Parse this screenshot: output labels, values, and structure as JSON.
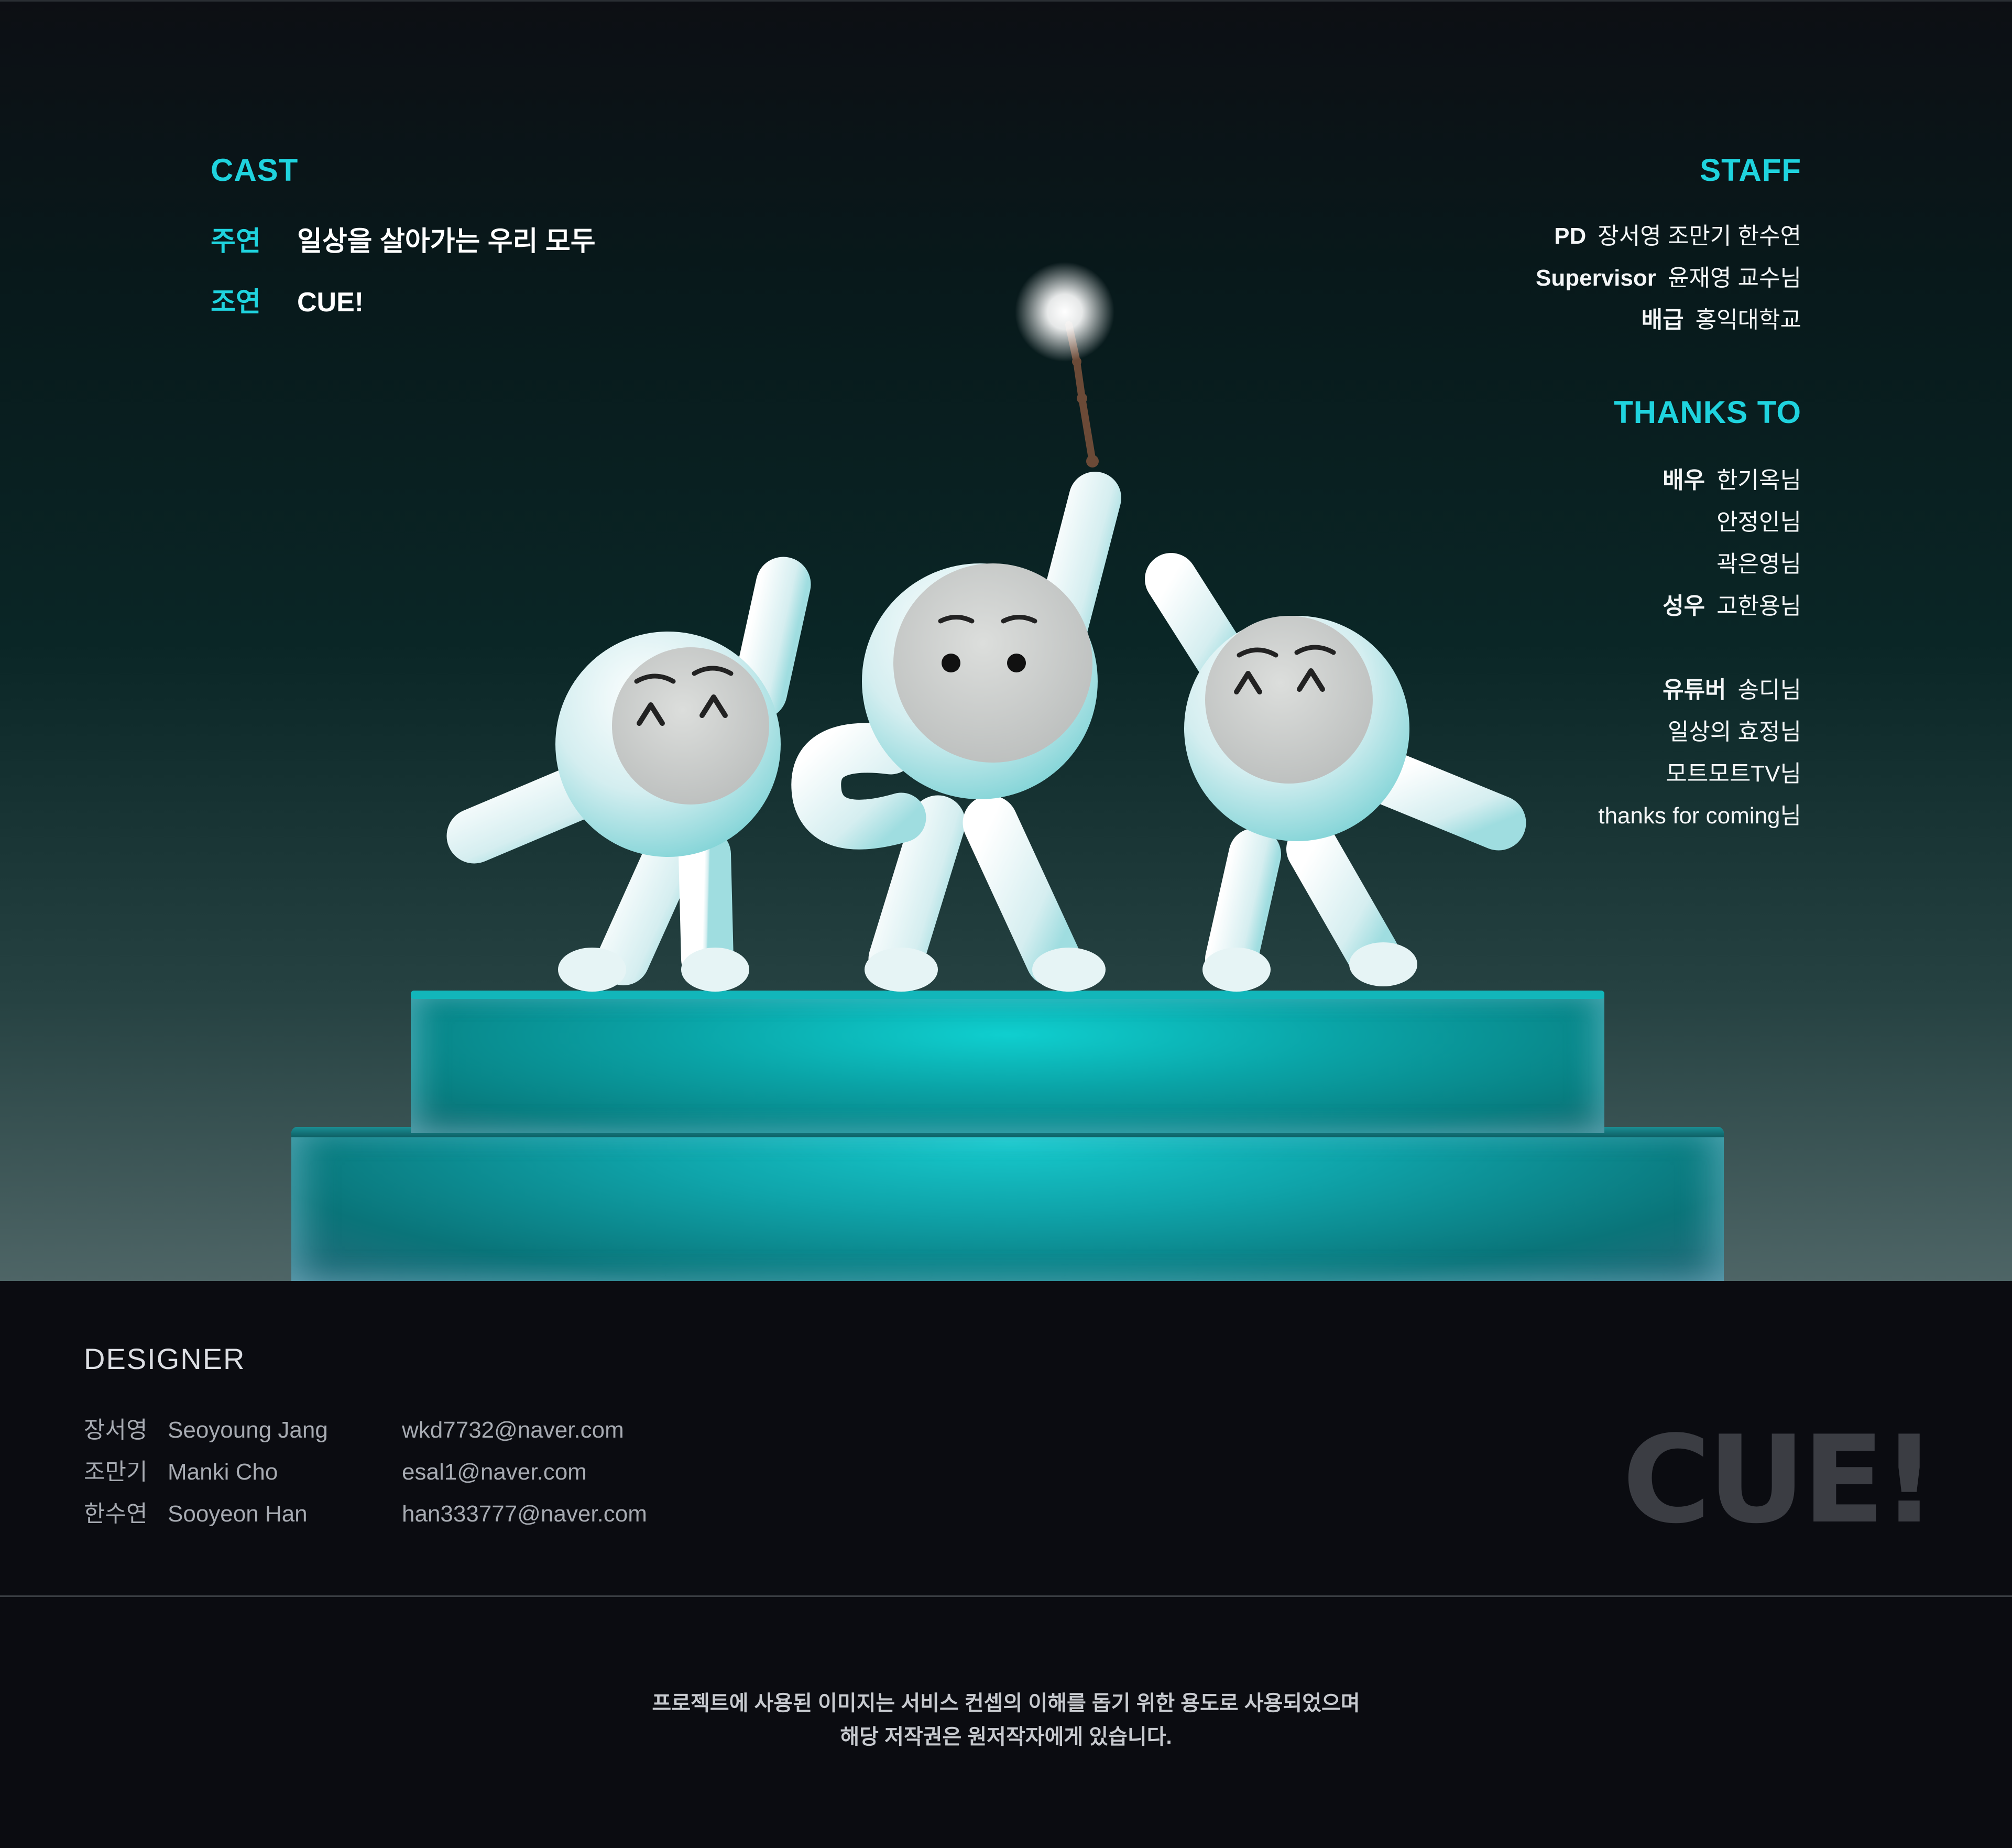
{
  "cast": {
    "title": "CAST",
    "rows": [
      {
        "role": "주연",
        "name": "일상을 살아가는 우리 모두"
      },
      {
        "role": "조연",
        "name": "CUE!"
      }
    ]
  },
  "staff": {
    "title": "STAFF",
    "rows": [
      {
        "key": "PD",
        "value": "장서영 조만기 한수연"
      },
      {
        "key": "Supervisor",
        "value": "윤재영 교수님"
      },
      {
        "key": "배급",
        "value": "홍익대학교"
      }
    ]
  },
  "thanks": {
    "title": "THANKS TO",
    "rows": [
      {
        "key": "배우",
        "value": "한기옥님"
      },
      {
        "key": "",
        "value": "안정인님"
      },
      {
        "key": "",
        "value": "곽은영님"
      },
      {
        "key": "성우",
        "value": "고한용님"
      },
      {
        "key": "유튜버",
        "value": "송디님"
      },
      {
        "key": "",
        "value": "일상의 효정님"
      },
      {
        "key": "",
        "value": "모트모트TV님"
      },
      {
        "key": "",
        "value": "thanks for coming님"
      }
    ]
  },
  "designer": {
    "title": "DESIGNER",
    "people": [
      {
        "kr": "장서영",
        "en": "Seoyoung Jang",
        "email": "wkd7732@naver.com"
      },
      {
        "kr": "조만기",
        "en": "Manki Cho",
        "email": "esal1@naver.com"
      },
      {
        "kr": "한수연",
        "en": "Sooyeon Han",
        "email": "han333777@naver.com"
      }
    ]
  },
  "logo": {
    "text": "CUE!"
  },
  "notice": {
    "line1": "프로젝트에 사용된 이미지는 서비스 컨셉의 이해를 돕기 위한 용도로 사용되었으며",
    "line2": "해당 저작권은 원저작자에게 있습니다."
  },
  "colors": {
    "accent": "#1fd3de",
    "background": "#0b0c11",
    "podium": "#0fa4aa",
    "character": "#d4eef0"
  },
  "icons": [
    "magic-wand-icon",
    "character-mascot"
  ]
}
